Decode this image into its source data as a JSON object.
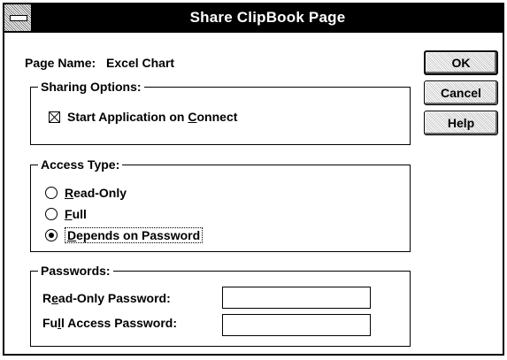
{
  "window": {
    "title": "Share ClipBook Page"
  },
  "page_name": {
    "label": "Page Name:",
    "value": "Excel Chart"
  },
  "sharing_options": {
    "legend": "Sharing Options:",
    "start_app": {
      "label": "Start Application on Connect",
      "checked": true
    }
  },
  "access_type": {
    "legend": "Access Type:",
    "options": [
      {
        "label": "Read-Only",
        "selected": false
      },
      {
        "label": "Full",
        "selected": false
      },
      {
        "label": "Depends on Password",
        "selected": true
      }
    ]
  },
  "passwords": {
    "legend": "Passwords:",
    "read_only_label": "Read-Only Password:",
    "full_access_label": "Full Access Password:",
    "read_only_value": "",
    "full_access_value": ""
  },
  "buttons": {
    "ok": "OK",
    "cancel": "Cancel",
    "help": "Help"
  }
}
